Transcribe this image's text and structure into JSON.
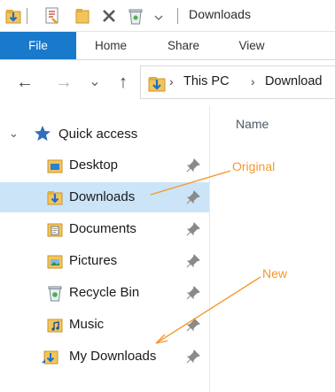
{
  "window": {
    "title": "Downloads",
    "quick_access_toolbar": [
      "properties-icon",
      "new-folder-icon",
      "delete-icon",
      "recycle-bin-icon",
      "customize-chevron-icon"
    ]
  },
  "ribbon": {
    "tabs": [
      {
        "label": "File",
        "active": true
      },
      {
        "label": "Home"
      },
      {
        "label": "Share"
      },
      {
        "label": "View"
      }
    ],
    "accent": "#1979ca"
  },
  "navigation": {
    "back_icon": "←",
    "forward_icon": "→",
    "recent_icon": "⌄",
    "up_icon": "↑"
  },
  "address_bar": {
    "segments": [
      "This PC",
      "Download"
    ],
    "separator": "›"
  },
  "nav_pane": {
    "quick_access_label": "Quick access",
    "items": [
      {
        "label": "Desktop",
        "icon": "desktop-folder-icon",
        "pinned": true
      },
      {
        "label": "Downloads",
        "icon": "downloads-folder-icon",
        "pinned": true,
        "selected": true
      },
      {
        "label": "Documents",
        "icon": "documents-folder-icon",
        "pinned": true
      },
      {
        "label": "Pictures",
        "icon": "pictures-folder-icon",
        "pinned": true
      },
      {
        "label": "Recycle Bin",
        "icon": "recycle-bin-icon",
        "pinned": true
      },
      {
        "label": "Music",
        "icon": "music-folder-icon",
        "pinned": true
      },
      {
        "label": "My Downloads",
        "icon": "my-downloads-folder-icon",
        "pinned": true
      }
    ],
    "selected_color": "#cce4f7"
  },
  "content": {
    "column_header": "Name"
  },
  "annotations": {
    "original": "Original",
    "new": "New",
    "color": "#f29a2e"
  }
}
